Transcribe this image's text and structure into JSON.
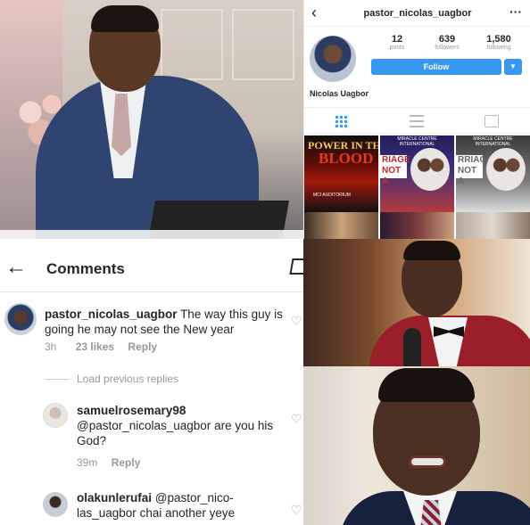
{
  "instagram_profile": {
    "username": "pastor_nicolas_uagbor",
    "more_icon": "more-horizontal-icon",
    "stats": [
      {
        "value": "12",
        "label": "posts"
      },
      {
        "value": "639",
        "label": "followers"
      },
      {
        "value": "1,580",
        "label": "following"
      }
    ],
    "follow_label": "Follow",
    "display_name": "Nicolas Uagbor",
    "accent_color": "#3897f0",
    "thumbnails": [
      {
        "line1": "POWER IN THE",
        "line2": "BLOOD",
        "line3": "MCI AUDITORIUM"
      },
      {
        "header": "MIRACLE CENTRE INTERNATIONAL",
        "banner": "RIAGE NOT A"
      },
      {
        "header": "MIRACLE CENTRE INTERNATIONAL",
        "banner": "RRIAGE NOT A"
      }
    ]
  },
  "comments": {
    "title": "Comments",
    "items": [
      {
        "username": "pastor_nicolas_uagbor",
        "text": "The way this guy is going he may not see the New year",
        "time": "3h",
        "likes": "23 likes",
        "reply_label": "Reply"
      },
      {
        "username": "samuelrosemary98",
        "mention": "@pastor_nicolas_uagbor",
        "text": "are you his God?",
        "time": "39m",
        "reply_label": "Reply"
      },
      {
        "username": "olakunlerufai",
        "mention_1": "@pastor_nico-",
        "mention_2": "las_uagbor",
        "text": "chai another yeye"
      }
    ],
    "load_previous": "Load previous replies"
  }
}
